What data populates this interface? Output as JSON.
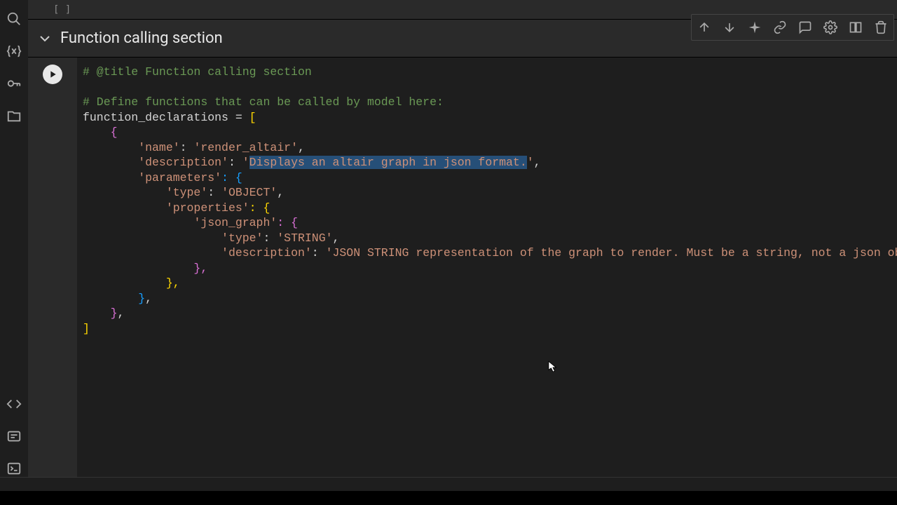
{
  "section": {
    "title": "Function calling section"
  },
  "empty_cell": "[ ]",
  "code": {
    "line1": "# @title Function calling section",
    "line2": "# Define functions that can be called by model here:",
    "line3_a": "function_declarations ",
    "line3_b": "=",
    "line3_c": " [",
    "line4": "    {",
    "line5_a": "        ",
    "line5_b": "'name'",
    "line5_c": ": ",
    "line5_d": "'render_altair'",
    "line5_e": ",",
    "line6_a": "        ",
    "line6_b": "'description'",
    "line6_c": ": ",
    "line6_d": "'",
    "line6_sel": "Displays an altair graph in json format.",
    "line6_e": "'",
    "line6_f": ",",
    "line7_a": "        ",
    "line7_b": "'parameters'",
    "line7_c": ": {",
    "line8_a": "            ",
    "line8_b": "'type'",
    "line8_c": ": ",
    "line8_d": "'OBJECT'",
    "line8_e": ",",
    "line9_a": "            ",
    "line9_b": "'properties'",
    "line9_c": ": {",
    "line10_a": "                ",
    "line10_b": "'json_graph'",
    "line10_c": ": {",
    "line11_a": "                    ",
    "line11_b": "'type'",
    "line11_c": ": ",
    "line11_d": "'STRING'",
    "line11_e": ",",
    "line12_a": "                    ",
    "line12_b": "'description'",
    "line12_c": ": ",
    "line12_d": "'JSON STRING representation of the graph to render. Must be a string, not a json object'",
    "line13": "                },",
    "line14": "            },",
    "line15": "        }",
    "line15_b": ",",
    "line16": "    }",
    "line16_b": ",",
    "line17": "]"
  }
}
